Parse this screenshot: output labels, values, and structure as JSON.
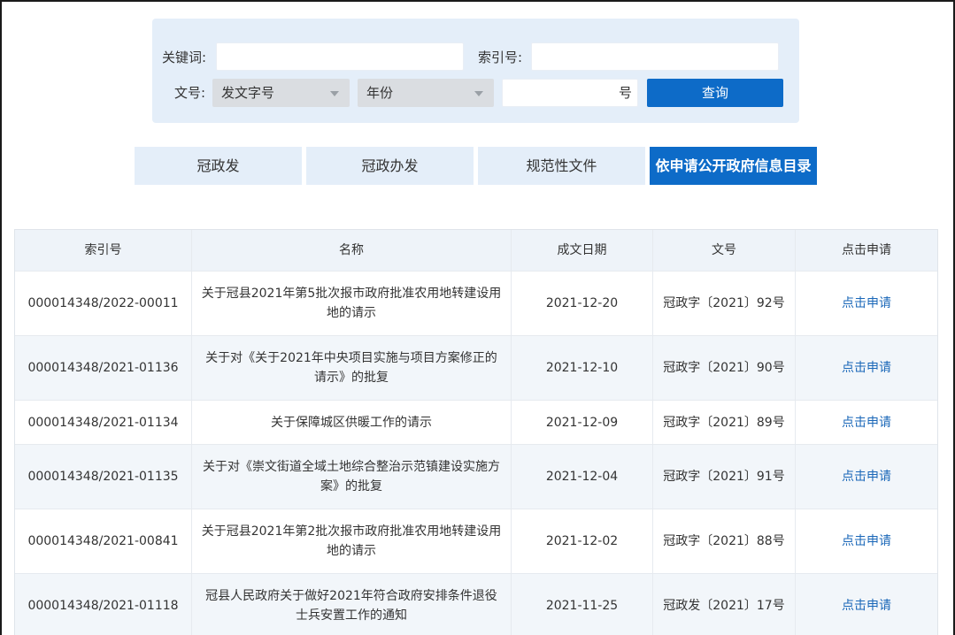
{
  "search": {
    "keyword_label": "关键词:",
    "keyword_value": "",
    "index_label": "索引号:",
    "index_value": "",
    "docno_label": "文号:",
    "doc_type_select": "发文字号",
    "year_select": "年份",
    "number_value": "",
    "number_suffix": "号",
    "query_button": "查询"
  },
  "tabs": [
    {
      "label": "冠政发",
      "active": false
    },
    {
      "label": "冠政办发",
      "active": false
    },
    {
      "label": "规范性文件",
      "active": false
    },
    {
      "label": "依申请公开政府信息目录",
      "active": true
    }
  ],
  "table": {
    "headers": [
      "索引号",
      "名称",
      "成文日期",
      "文号",
      "点击申请"
    ],
    "rows": [
      {
        "index": "000014348/2022-00011",
        "name": "关于冠县2021年第5批次报市政府批准农用地转建设用地的请示",
        "date": "2021-12-20",
        "docno": "冠政字〔2021〕92号",
        "action": "点击申请"
      },
      {
        "index": "000014348/2021-01136",
        "name": "关于对《关于2021年中央项目实施与项目方案修正的请示》的批复",
        "date": "2021-12-10",
        "docno": "冠政字〔2021〕90号",
        "action": "点击申请"
      },
      {
        "index": "000014348/2021-01134",
        "name": "关于保障城区供暖工作的请示",
        "date": "2021-12-09",
        "docno": "冠政字〔2021〕89号",
        "action": "点击申请"
      },
      {
        "index": "000014348/2021-01135",
        "name": "关于对《崇文街道全域土地综合整治示范镇建设实施方案》的批复",
        "date": "2021-12-04",
        "docno": "冠政字〔2021〕91号",
        "action": "点击申请"
      },
      {
        "index": "000014348/2021-00841",
        "name": "关于冠县2021年第2批次报市政府批准农用地转建设用地的请示",
        "date": "2021-12-02",
        "docno": "冠政字〔2021〕88号",
        "action": "点击申请"
      },
      {
        "index": "000014348/2021-01118",
        "name": "冠县人民政府关于做好2021年符合政府安排条件退役士兵安置工作的通知",
        "date": "2021-11-25",
        "docno": "冠政发〔2021〕17号",
        "action": "点击申请"
      }
    ]
  },
  "colors": {
    "accent": "#0d6bc8",
    "panel": "#e4eef9",
    "link": "#1a67b8"
  }
}
